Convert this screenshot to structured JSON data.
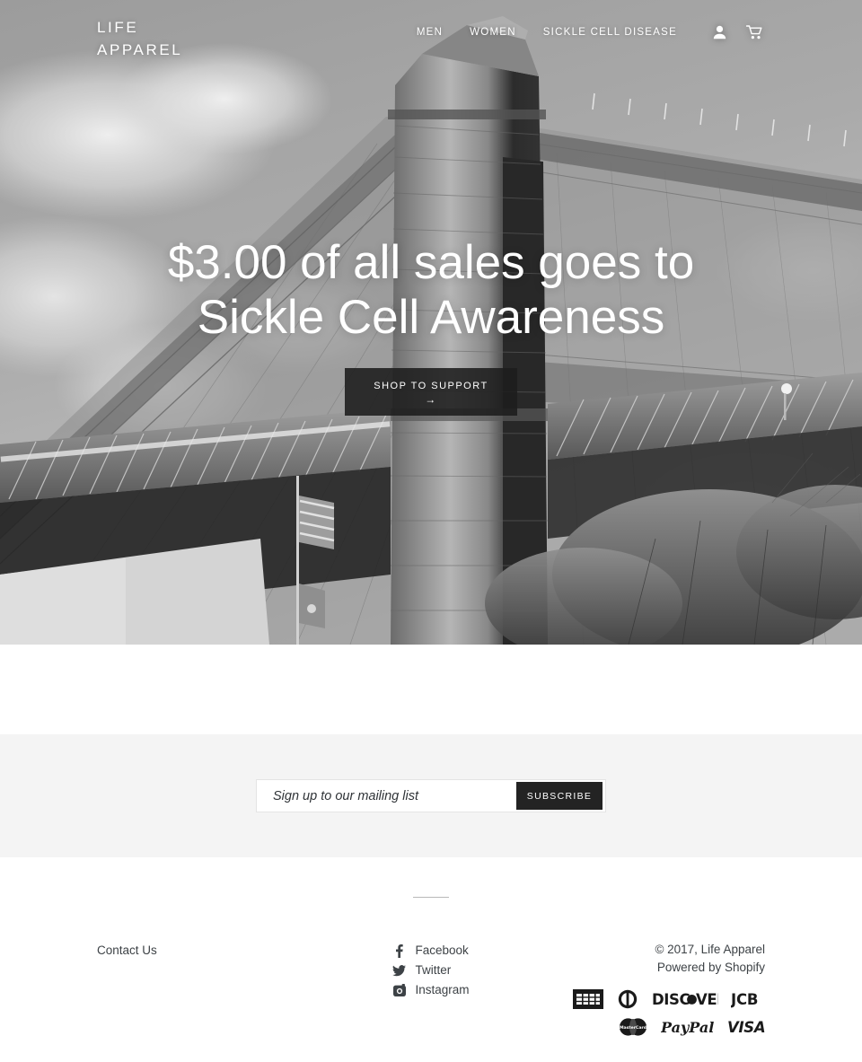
{
  "header": {
    "logo_line1": "LIFE",
    "logo_line2": "APPAREL",
    "nav": [
      {
        "label": "MEN"
      },
      {
        "label": "WOMEN"
      },
      {
        "label": "SICKLE CELL DISEASE"
      }
    ],
    "account_icon": "person-icon",
    "cart_icon": "shopping-cart-icon"
  },
  "hero": {
    "headline_line1": "$3.00 of all sales goes to",
    "headline_line2": "Sickle Cell Awareness",
    "button_label": "SHOP TO SUPPORT",
    "button_arrow": "→",
    "image_description": "Black and white photograph of the Brooklyn Bridge stone tower with suspension cables and clouds"
  },
  "newsletter": {
    "placeholder": "Sign up to our mailing list",
    "value": "",
    "submit_label": "SUBSCRIBE"
  },
  "footer": {
    "contact_label": "Contact Us",
    "social": [
      {
        "label": "Facebook",
        "icon": "facebook-icon"
      },
      {
        "label": "Twitter",
        "icon": "twitter-icon"
      },
      {
        "label": "Instagram",
        "icon": "instagram-icon"
      }
    ],
    "copyright": "© 2017, Life Apparel",
    "powered_prefix": "Powered by ",
    "powered_link": "Shopify",
    "payments": [
      {
        "name": "american-express"
      },
      {
        "name": "diners-club"
      },
      {
        "name": "discover"
      },
      {
        "name": "jcb"
      },
      {
        "name": "master"
      },
      {
        "name": "paypal"
      },
      {
        "name": "visa"
      }
    ]
  },
  "colors": {
    "dark": "#232323",
    "text": "#3d4246",
    "newsletter_band": "#f4f4f4"
  }
}
